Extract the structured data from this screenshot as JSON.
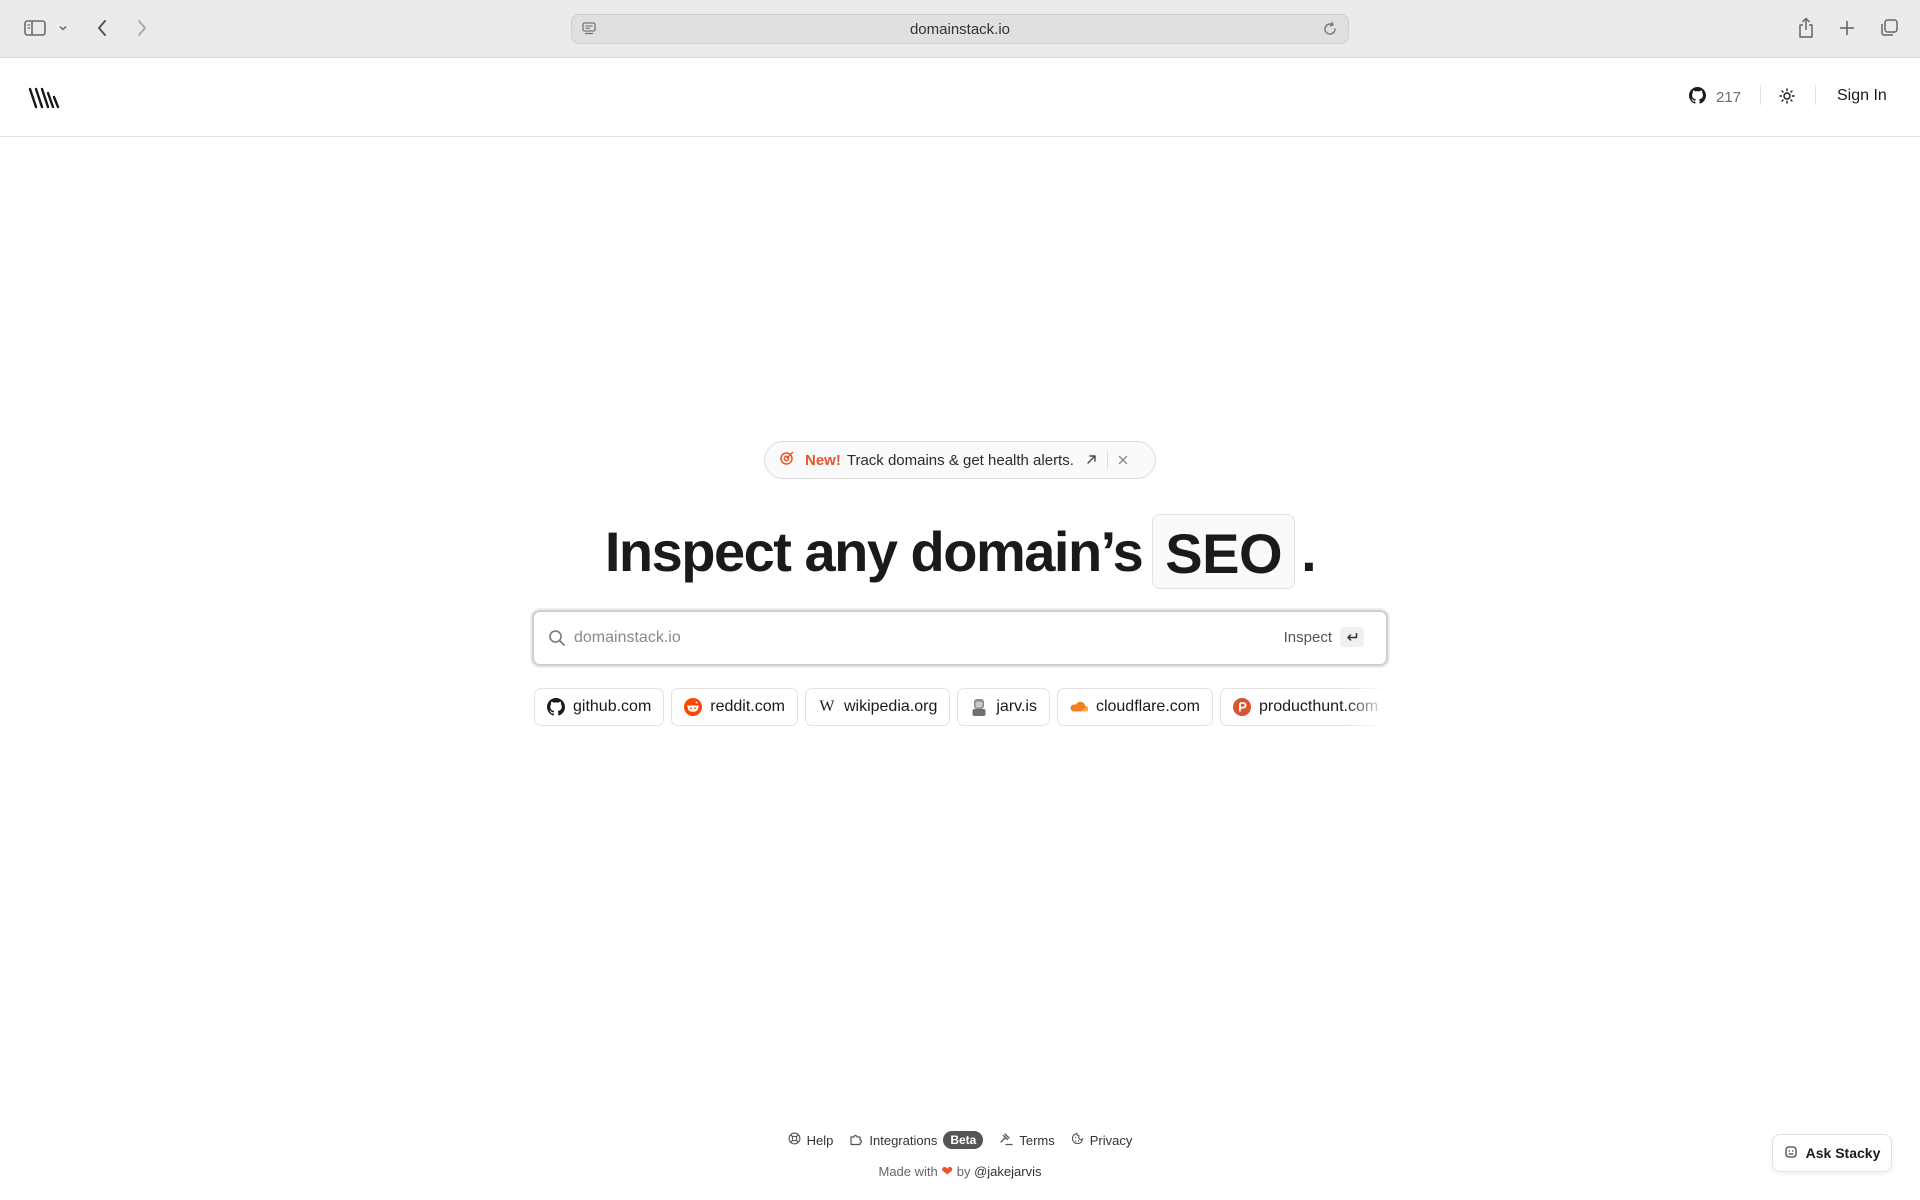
{
  "browser": {
    "url": "domainstack.io"
  },
  "header": {
    "github_stars": "217",
    "signin_label": "Sign In"
  },
  "announcement": {
    "tag": "New!",
    "message": "Track domains & get health alerts."
  },
  "hero": {
    "headline": "Inspect any domain’s",
    "highlight": "SEO",
    "period": "."
  },
  "search": {
    "placeholder": "domainstack.io",
    "button_label": "Inspect"
  },
  "suggestions": [
    {
      "label": "github.com",
      "icon": "github-icon"
    },
    {
      "label": "reddit.com",
      "icon": "reddit-icon"
    },
    {
      "label": "wikipedia.org",
      "icon": "wikipedia-icon"
    },
    {
      "label": "jarv.is",
      "icon": "avatar-icon"
    },
    {
      "label": "cloudflare.com",
      "icon": "cloudflare-icon"
    },
    {
      "label": "producthunt.com",
      "icon": "producthunt-icon"
    }
  ],
  "footer": {
    "help": "Help",
    "integrations": "Integrations",
    "beta": "Beta",
    "terms": "Terms",
    "privacy": "Privacy",
    "made_with": "Made with",
    "by": "by",
    "handle": "@jakejarvis"
  },
  "ask": {
    "label": "Ask Stacky"
  },
  "colors": {
    "accent": "#e8542b",
    "text": "#1a1a1a",
    "border": "#e2e2e2"
  }
}
